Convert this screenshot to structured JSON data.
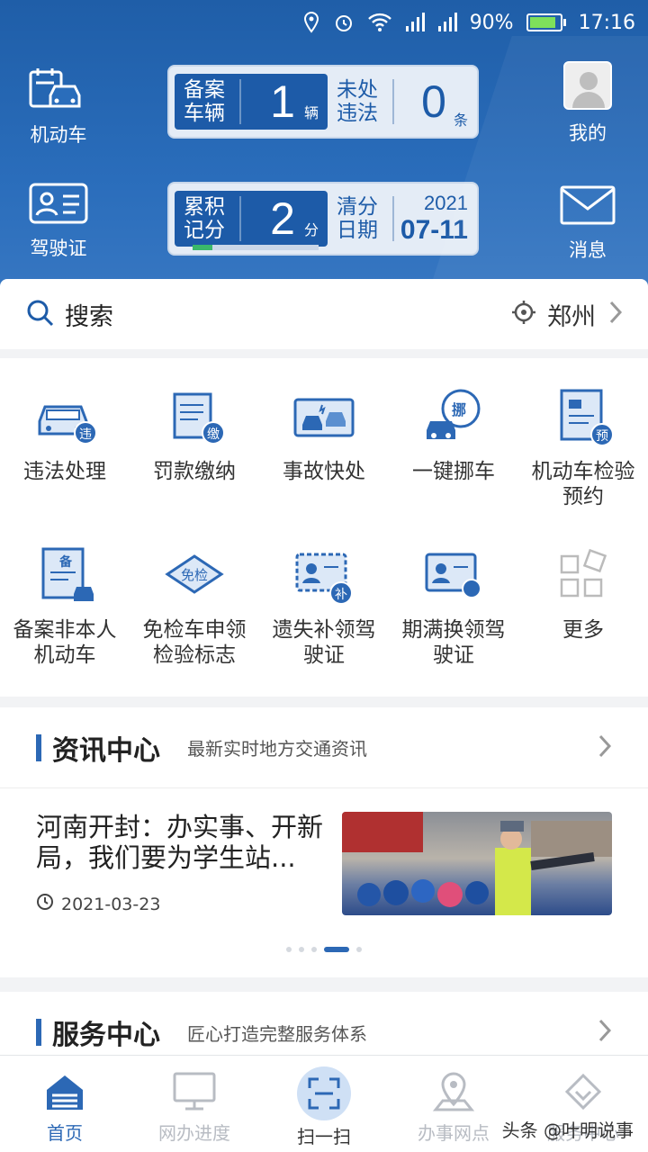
{
  "status_bar": {
    "battery": "90%",
    "time": "17:16"
  },
  "header": {
    "motor_vehicle_label": "机动车",
    "license_label": "驾驶证",
    "mine_label": "我的",
    "message_label": "消息",
    "card1": {
      "left_label": "备案车辆",
      "left_value": "1",
      "left_unit": "辆",
      "right_label": "未处违法",
      "right_value": "0",
      "right_unit": "条"
    },
    "card2": {
      "left_label": "累积记分",
      "left_value": "2",
      "left_unit": "分",
      "right_label": "清分日期",
      "year": "2021",
      "month_day": "07-11"
    }
  },
  "search": {
    "label": "搜索",
    "city": "郑州"
  },
  "services": [
    {
      "label": "违法处理",
      "badge": "违"
    },
    {
      "label": "罚款缴纳",
      "badge": "缴"
    },
    {
      "label": "事故快处",
      "badge": ""
    },
    {
      "label": "一键挪车",
      "badge": "挪"
    },
    {
      "label": "机动车检验预约",
      "badge": "预"
    },
    {
      "label": "备案非本人机动车",
      "badge": "备"
    },
    {
      "label": "免检车申领检验标志",
      "badge": "免检"
    },
    {
      "label": "遗失补领驾驶证",
      "badge": "补"
    },
    {
      "label": "期满换领驾驶证",
      "badge": ""
    },
    {
      "label": "更多",
      "badge": ""
    }
  ],
  "news": {
    "title": "资讯中心",
    "subtitle": "最新实时地方交通资讯",
    "item_title": "河南开封：办实事、开新局，我们要为学生站...",
    "item_date": "2021-03-23"
  },
  "service_center": {
    "title": "服务中心",
    "subtitle": "匠心打造完整服务体系"
  },
  "nav": [
    {
      "label": "首页"
    },
    {
      "label": "网办进度"
    },
    {
      "label": "扫一扫"
    },
    {
      "label": "办事网点"
    },
    {
      "label": "服务中心"
    }
  ],
  "watermark": "头条 @叶明说事",
  "colors": {
    "primary": "#2c68b5",
    "header_bg": "#1f5ea8"
  }
}
